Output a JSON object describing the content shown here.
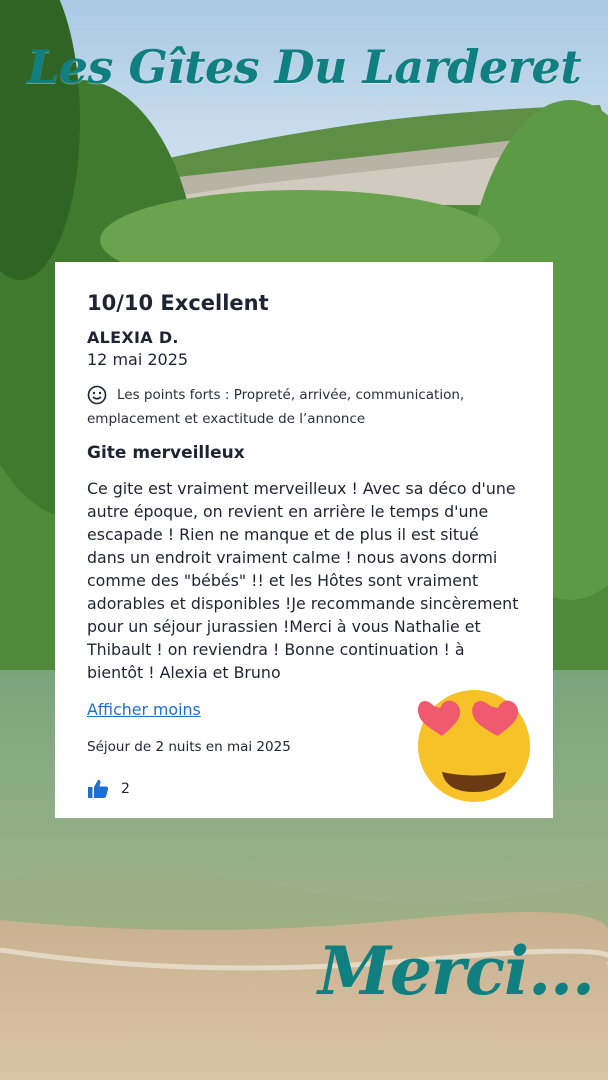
{
  "header": {
    "title": "Les Gîtes Du Larderet"
  },
  "review": {
    "rating": "10/10 Excellent",
    "author": "ALEXIA D.",
    "date": "12 mai 2025",
    "highlights": "Les points forts : Propreté, arrivée, communication, emplacement et exactitude de l’annonce",
    "title": "Gite merveilleux",
    "text": "Ce gite est vraiment merveilleux ! Avec sa déco d'une autre époque, on revient en arrière le temps d'une escapade ! Rien ne manque et de plus il est situé dans un endroit vraiment calme ! nous avons dormi comme des \"bébés\" !! et les Hôtes sont vraiment adorables et disponibles !Je recommande sincèrement pour un séjour jurassien !Merci à vous Nathalie et Thibault ! on reviendra ! Bonne continuation ! à bientôt ! Alexia et Bruno",
    "show_less": "Afficher moins",
    "stay": "Séjour de 2 nuits en mai 2025",
    "likes": "2"
  },
  "footer": {
    "thanks": "Merci..."
  },
  "icons": {
    "highlights": "smile-icon",
    "likes": "thumbs-up-icon",
    "emoji": "heart-eyes-emoji"
  },
  "colors": {
    "accent": "#0f7f7f",
    "link": "#1f6fd1"
  }
}
